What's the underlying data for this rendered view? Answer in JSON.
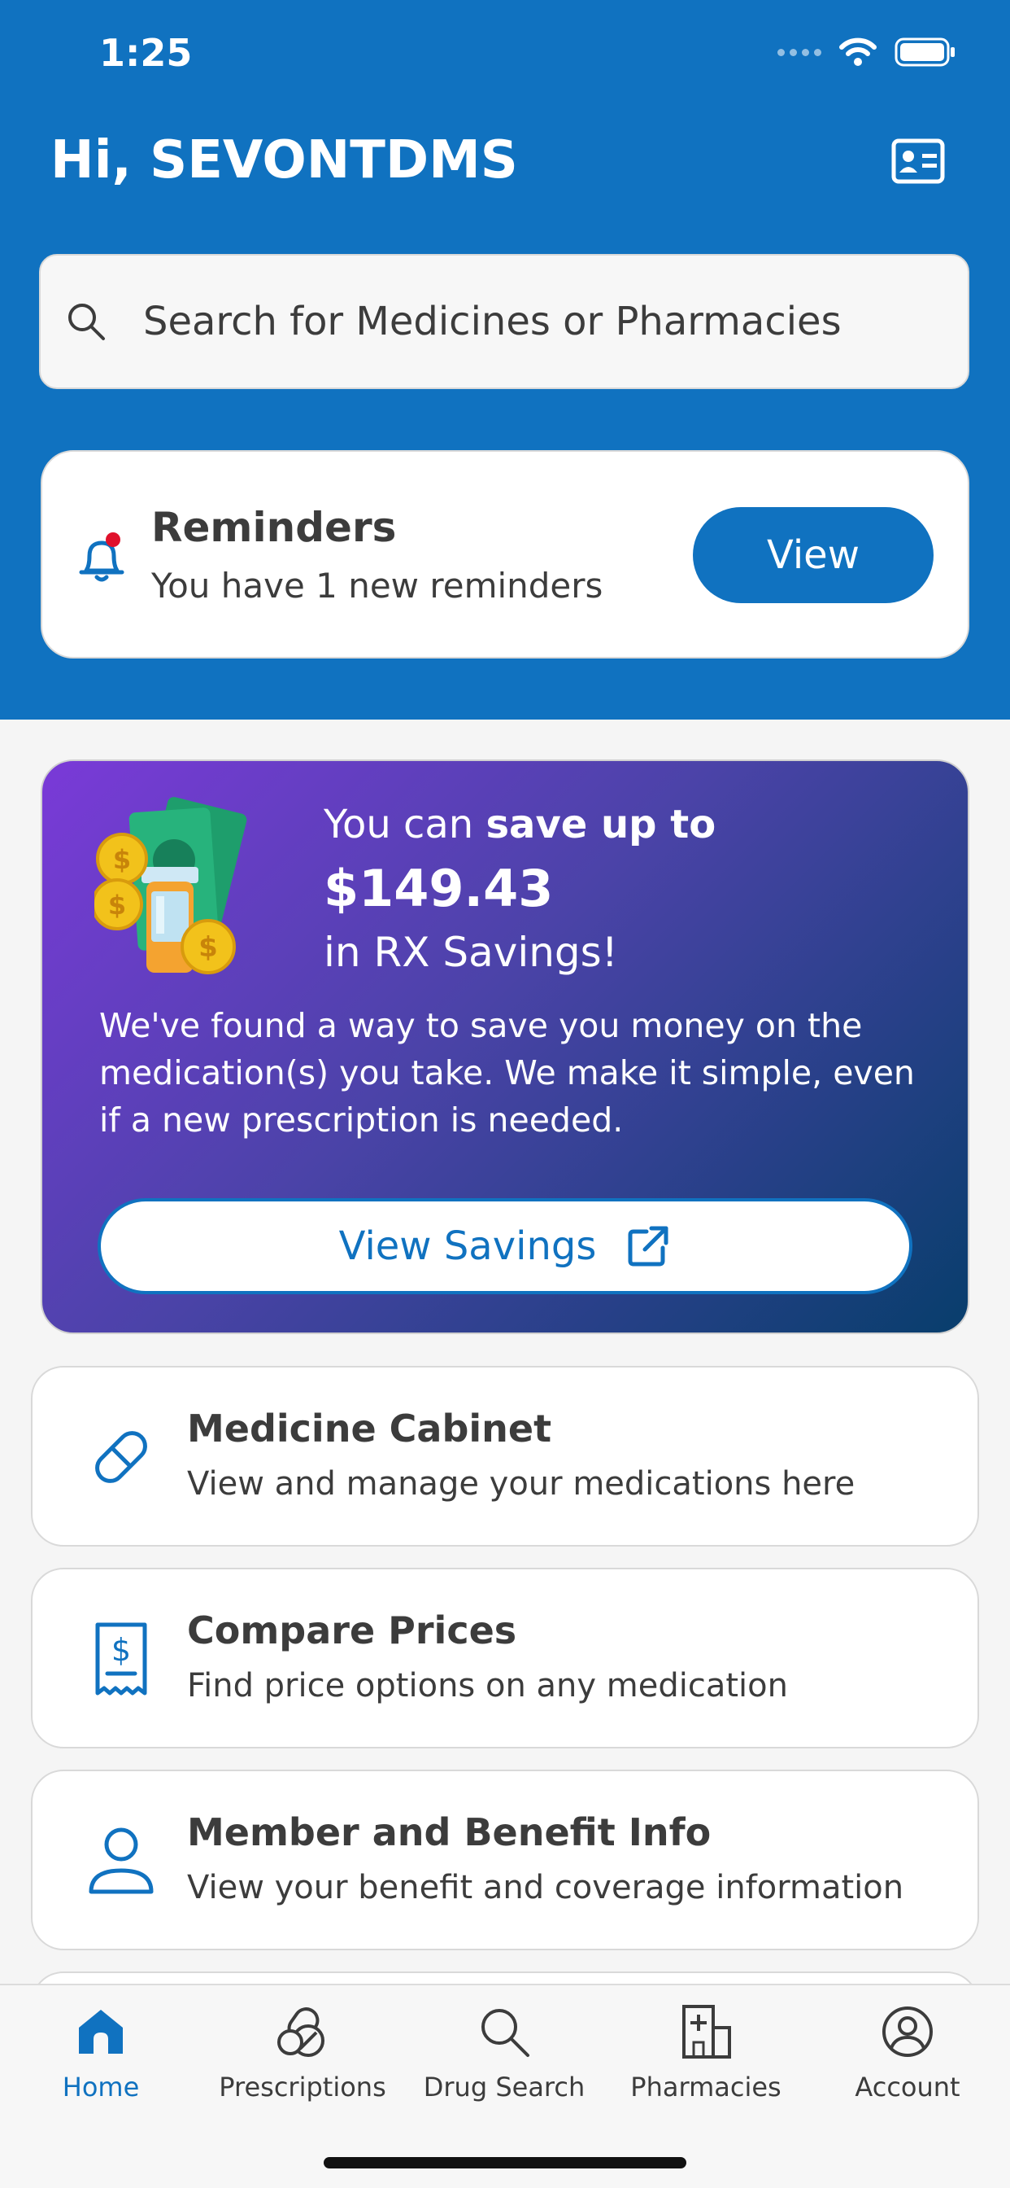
{
  "status": {
    "time": "1:25"
  },
  "header": {
    "greeting": "Hi, SEVONTDMS"
  },
  "search": {
    "placeholder": "Search for Medicines or Pharmacies"
  },
  "reminders": {
    "title": "Reminders",
    "subtitle": "You have 1 new reminders",
    "button": "View"
  },
  "promo": {
    "line1_prefix": "You can ",
    "line1_bold": "save up to",
    "amount": "$149.43",
    "line3": "in RX Savings!",
    "body": "We've found a way to save you money on the medication(s) you take. We make it simple, even if a new prescription is needed.",
    "button": "View Savings"
  },
  "tiles": [
    {
      "title": "Medicine Cabinet",
      "subtitle": "View and manage your medications here",
      "icon": "pill-icon"
    },
    {
      "title": "Compare Prices",
      "subtitle": "Find price options on any medication",
      "icon": "receipt-dollar-icon"
    },
    {
      "title": "Member and Benefit Info",
      "subtitle": "View your benefit and coverage information",
      "icon": "person-icon"
    }
  ],
  "tabbar": [
    {
      "label": "Home",
      "icon": "home-icon",
      "active": true
    },
    {
      "label": "Prescriptions",
      "icon": "prescriptions-icon",
      "active": false
    },
    {
      "label": "Drug Search",
      "icon": "search-icon",
      "active": false
    },
    {
      "label": "Pharmacies",
      "icon": "pharmacy-icon",
      "active": false
    },
    {
      "label": "Account",
      "icon": "account-icon",
      "active": false
    }
  ],
  "colors": {
    "brand_blue": "#1072c0",
    "promo_start": "#7a3ad8",
    "promo_end": "#083e6c",
    "background": "#f5f5f5"
  }
}
